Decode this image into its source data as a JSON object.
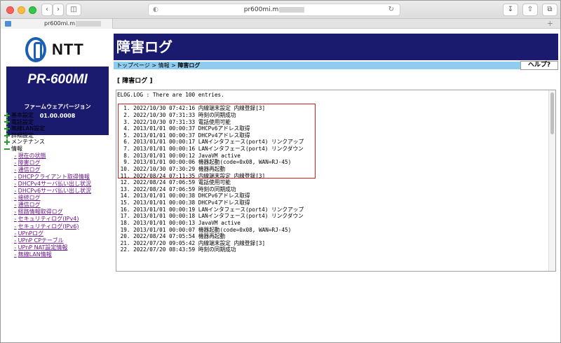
{
  "browser": {
    "url": "pr600mi.m",
    "tab_title": "pr600mi.m"
  },
  "sidebar": {
    "brand": "NTT",
    "model": "PR-600MI",
    "fw_label": "ファームウェアバージョン",
    "fw_version": "01.00.0008",
    "groups": [
      "基本設定",
      "電話設定",
      "無線LAN設定",
      "詳細設定",
      "メンテナンス",
      "情報"
    ],
    "info_items": [
      "現在の状態",
      "障害ログ",
      "通信ログ",
      "DHCPクライアント取得情報",
      "DHCPv4サーバ払い出し状況",
      "DHCPv6サーバ払い出し状況",
      "接続ログ",
      "通信ログ",
      "経路情報取得ログ",
      "セキュリティログ(IPv4)",
      "セキュリティログ(IPv6)",
      "UPnPログ",
      "UPnP CPテーブル",
      "UPnP NAT設定情報",
      "無線LAN情報"
    ]
  },
  "main": {
    "title": "障害ログ",
    "breadcrumb": {
      "top": "トップページ",
      "sep1": " > ",
      "info": "情報",
      "sep2": " > ",
      "current": "障害ログ"
    },
    "help": "ヘルプ?",
    "section_title": "[ 障害ログ ]",
    "log_header": "ELOG.LOG : There are 100 entries.",
    "log_entries": [
      "  1. 2022/10/30 07:42:16 内線端末設定 内線登録[3]",
      "  2. 2022/10/30 07:31:33 時刻の同期成功",
      "  3. 2022/10/30 07:31:33 電話使用可能",
      "  4. 2013/01/01 00:00:37 DHCPv6アドレス取得",
      "  5. 2013/01/01 00:00:37 DHCPv4アドレス取得",
      "  6. 2013/01/01 00:00:17 LANインタフェース(port4) リンクアップ",
      "  7. 2013/01/01 00:00:16 LANインタフェース(port4) リンクダウン",
      "  8. 2013/01/01 00:00:12 JavaVM active",
      "  9. 2013/01/01 00:00:06 機器起動(code=0x08, WAN=RJ-45)",
      " 10. 2022/10/30 07:30:29 機器再起動",
      " 11. 2022/08/24 07:11:35 内線端末設定 内線登録[3]",
      " 12. 2022/08/24 07:06:59 電話使用可能",
      " 13. 2022/08/24 07:06:59 時刻の同期成功",
      " 14. 2013/01/01 00:00:38 DHCPv6アドレス取得",
      " 15. 2013/01/01 00:00:38 DHCPv4アドレス取得",
      " 16. 2013/01/01 00:00:19 LANインタフェース(port4) リンクアップ",
      " 17. 2013/01/01 00:00:18 LANインタフェース(port4) リンクダウン",
      " 18. 2013/01/01 00:00:13 JavaVM active",
      " 19. 2013/01/01 00:00:07 機器起動(code=0x08, WAN=RJ-45)",
      " 20. 2022/08/24 07:05:54 機器再起動",
      " 21. 2022/07/20 09:05:42 内線端末設定 内線登録[3]",
      " 22. 2022/07/20 08:43:59 時刻の同期成功"
    ]
  }
}
